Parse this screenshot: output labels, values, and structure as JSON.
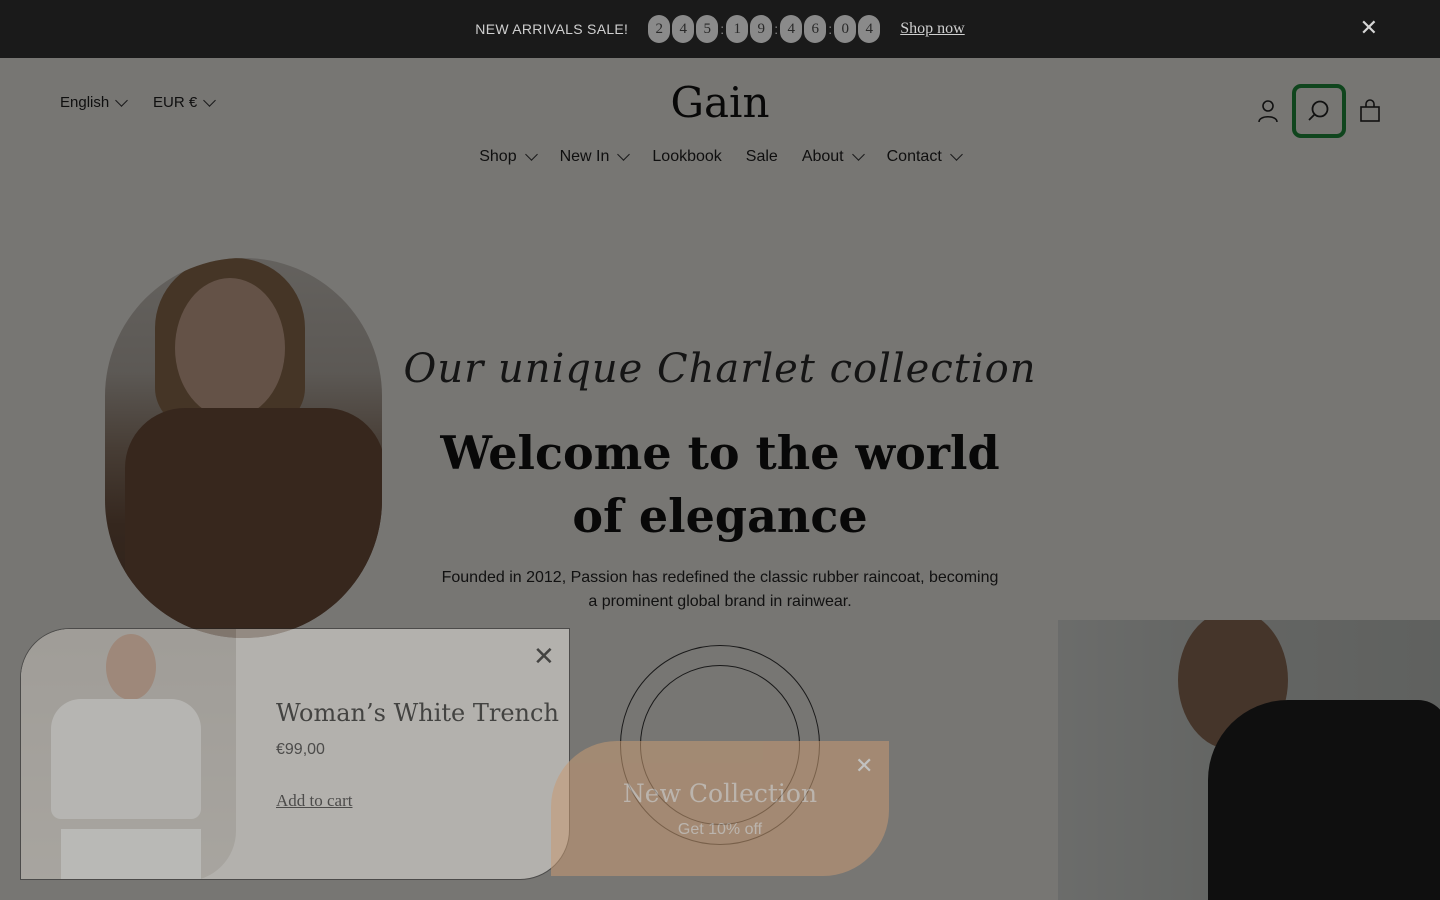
{
  "announcement": {
    "text": "NEW ARRIVALS SALE!",
    "countdown": [
      "2",
      "4",
      "5",
      ":",
      "1",
      "9",
      ":",
      "4",
      "6",
      ":",
      "0",
      "4"
    ],
    "link": "Shop now",
    "close": "✕"
  },
  "header": {
    "language": "English",
    "currency": "EUR €",
    "logo": "Gain",
    "icons": [
      "account-icon",
      "search-icon",
      "cart-icon"
    ]
  },
  "nav": {
    "items": [
      {
        "label": "Shop",
        "dropdown": true
      },
      {
        "label": "New In",
        "dropdown": true
      },
      {
        "label": "Lookbook",
        "dropdown": false
      },
      {
        "label": "Sale",
        "dropdown": false
      },
      {
        "label": "About",
        "dropdown": true
      },
      {
        "label": "Contact",
        "dropdown": true
      }
    ]
  },
  "hero": {
    "script": "Our unique Charlet collection",
    "headline": "Welcome to the world of elegance",
    "description": "Founded in 2012, Passion has redefined the classic rubber raincoat, becoming a prominent global brand in rainwear."
  },
  "product_popup": {
    "title": "Woman’s White Trench",
    "price": "€99,00",
    "cta": "Add to cart",
    "close": "✕"
  },
  "collection_popup": {
    "title": "New Collection",
    "subtitle": "Get 10% off",
    "close": "✕"
  },
  "colors": {
    "focus_ring": "#1f8a3a",
    "collection_bg": "#c79a73",
    "topbar_bg": "#1a1a1a"
  }
}
